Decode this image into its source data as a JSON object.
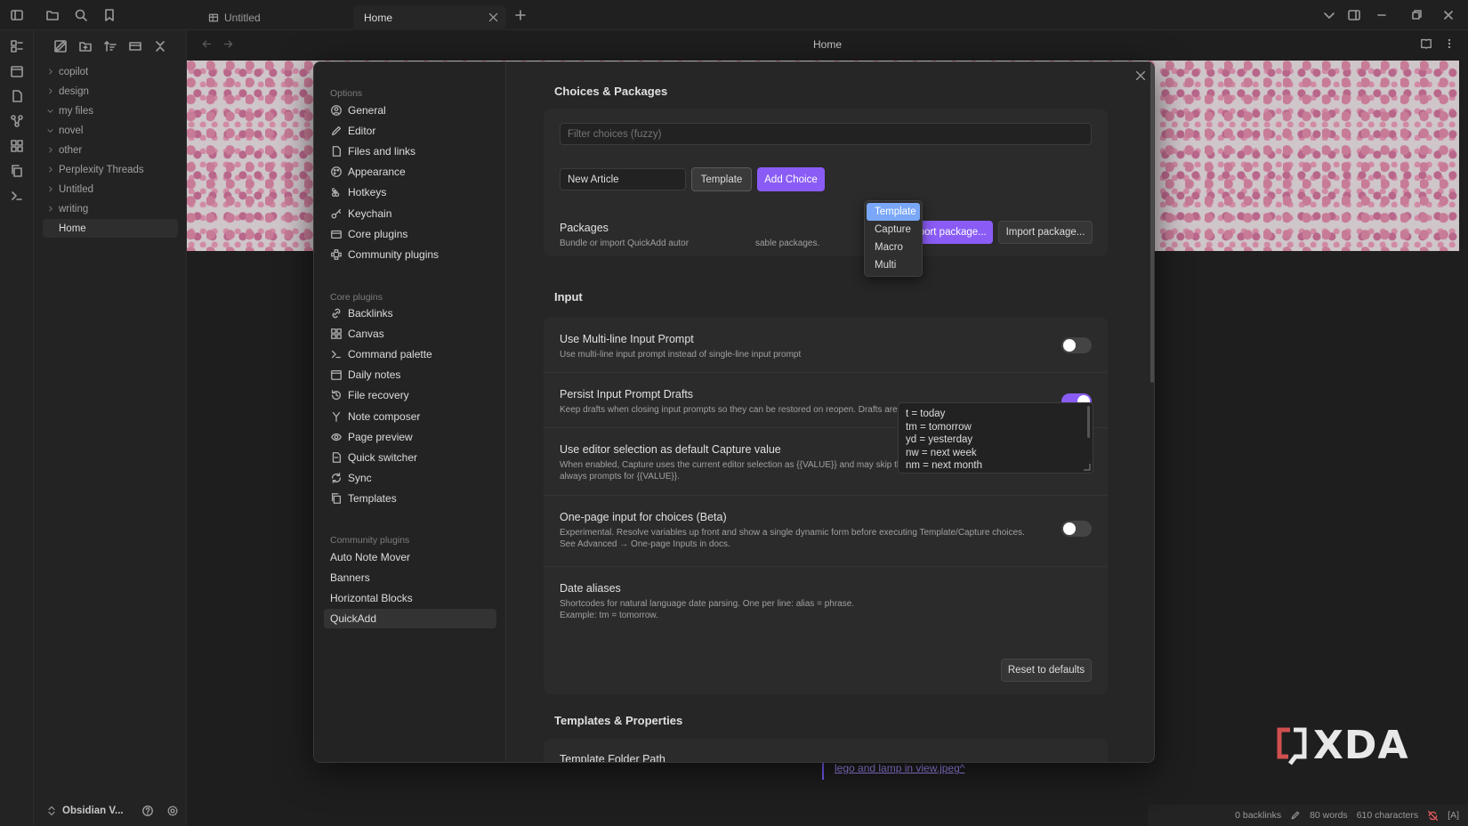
{
  "tabs": [
    {
      "label": "Untitled",
      "active": false
    },
    {
      "label": "Home",
      "active": true
    }
  ],
  "view_title": "Home",
  "sidebar": {
    "tree": [
      {
        "label": "copilot",
        "open": false
      },
      {
        "label": "design",
        "open": false
      },
      {
        "label": "my files",
        "open": true
      },
      {
        "label": "novel",
        "open": true
      },
      {
        "label": "other",
        "open": false
      },
      {
        "label": "Perplexity Threads",
        "open": false
      },
      {
        "label": "Untitled",
        "open": false
      },
      {
        "label": "writing",
        "open": false
      }
    ],
    "active_file": "Home",
    "vault": "Obsidian V..."
  },
  "doc_link": "lego and lamp in view.jpeg^",
  "status": {
    "backlinks": "0 backlinks",
    "words": "80 words",
    "chars": "610 characters",
    "mode": "[A]"
  },
  "watermark": "XDA",
  "modal": {
    "nav": {
      "options_head": "Options",
      "options": [
        "General",
        "Editor",
        "Files and links",
        "Appearance",
        "Hotkeys",
        "Keychain",
        "Core plugins",
        "Community plugins"
      ],
      "core_head": "Core plugins",
      "core": [
        "Backlinks",
        "Canvas",
        "Command palette",
        "Daily notes",
        "File recovery",
        "Note composer",
        "Page preview",
        "Quick switcher",
        "Sync",
        "Templates"
      ],
      "community_head": "Community plugins",
      "community": [
        "Auto Note Mover",
        "Banners",
        "Horizontal Blocks",
        "QuickAdd"
      ],
      "active": "QuickAdd"
    },
    "choices": {
      "title": "Choices & Packages",
      "filter_placeholder": "Filter choices (fuzzy)",
      "name_value": "New Article",
      "type_value": "Template",
      "add_label": "Add Choice",
      "dropdown_options": [
        "Template",
        "Capture",
        "Macro",
        "Multi"
      ],
      "packages_name": "Packages",
      "packages_desc": "Bundle or import QuickAdd autor",
      "packages_desc_tail": "sable packages.",
      "export_label": "Export package...",
      "import_label": "Import package..."
    },
    "input": {
      "title": "Input",
      "settings": [
        {
          "name": "Use Multi-line Input Prompt",
          "desc": "Use multi-line input prompt instead of single-line input prompt",
          "on": false
        },
        {
          "name": "Persist Input Prompt Drafts",
          "desc": "Keep drafts when closing input prompts so they can be restored on reopen. Drafts are stored only for this session.",
          "on": true
        },
        {
          "name": "Use editor selection as default Capture value",
          "desc": "When enabled, Capture uses the current editor selection as {{VALUE}} and may skip the prompt. When disabled, Capture always prompts for {{VALUE}}.",
          "on": true
        },
        {
          "name": "One-page input for choices (Beta)",
          "desc": "Experimental. Resolve variables up front and show a single dynamic form before executing Template/Capture choices. See Advanced → One-page Inputs in docs.",
          "on": false
        }
      ],
      "date_aliases_name": "Date aliases",
      "date_aliases_desc": "Shortcodes for natural language date parsing. One per line: alias = phrase. Example: tm = tomorrow.",
      "date_aliases_lines": [
        "t = today",
        "tm = tomorrow",
        "yd = yesterday",
        "nw = next week",
        "nm = next month"
      ],
      "reset_label": "Reset to defaults"
    },
    "templates": {
      "title": "Templates & Properties",
      "folder_label": "Template Folder Path"
    }
  },
  "colors": {
    "accent": "#8a5cf5",
    "dropdown_selected": "#7aa7f7",
    "background": "#1e1e1e"
  }
}
